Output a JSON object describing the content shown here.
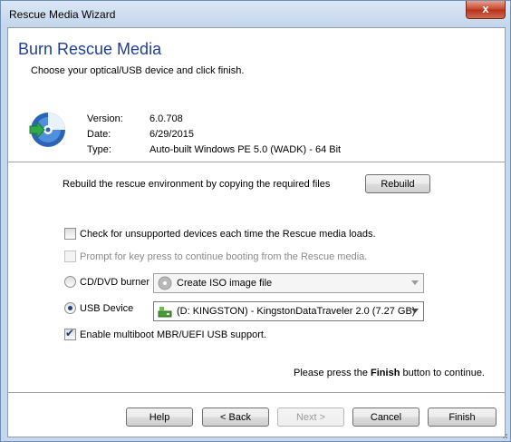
{
  "window": {
    "title": "Rescue Media Wizard",
    "close_glyph": "x"
  },
  "page": {
    "heading": "Burn Rescue Media",
    "subheading": "Choose your optical/USB device and click finish."
  },
  "info": {
    "version_label": "Version:",
    "version_value": "6.0.708",
    "date_label": "Date:",
    "date_value": "6/29/2015",
    "type_label": "Type:",
    "type_value": "Auto-built Windows PE 5.0 (WADK) - 64 Bit",
    "icon": "cd-disc-arrow-icon"
  },
  "rebuild": {
    "text": "Rebuild the rescue environment by copying the required files",
    "button": "Rebuild"
  },
  "options": {
    "check_unsupported": {
      "label": "Check for unsupported devices each time the Rescue media loads.",
      "checked": false
    },
    "prompt_key": {
      "label": "Prompt for key press to continue booting from the Rescue media.",
      "checked": false,
      "disabled": true
    },
    "cd_dvd": {
      "label": "CD/DVD burner",
      "selected": false,
      "combo_value": "Create ISO image file",
      "combo_icon": "disc-icon"
    },
    "usb": {
      "label": "USB Device",
      "selected": true,
      "combo_value": "(D: KINGSTON) - KingstonDataTraveler 2.0 (7.27 GB)",
      "combo_icon": "usb-drive-icon"
    },
    "multiboot": {
      "label": "Enable multiboot MBR/UEFI USB support.",
      "checked": true
    }
  },
  "footer": {
    "continue_prefix": "Please press the ",
    "continue_bold": "Finish",
    "continue_suffix": " button to continue.",
    "buttons": {
      "help": "Help",
      "back": "< Back",
      "next": "Next >",
      "cancel": "Cancel",
      "finish": "Finish"
    }
  },
  "colors": {
    "heading": "#1e3f9a",
    "titlebar": "#c4d5ec",
    "close": "#c7432b"
  }
}
